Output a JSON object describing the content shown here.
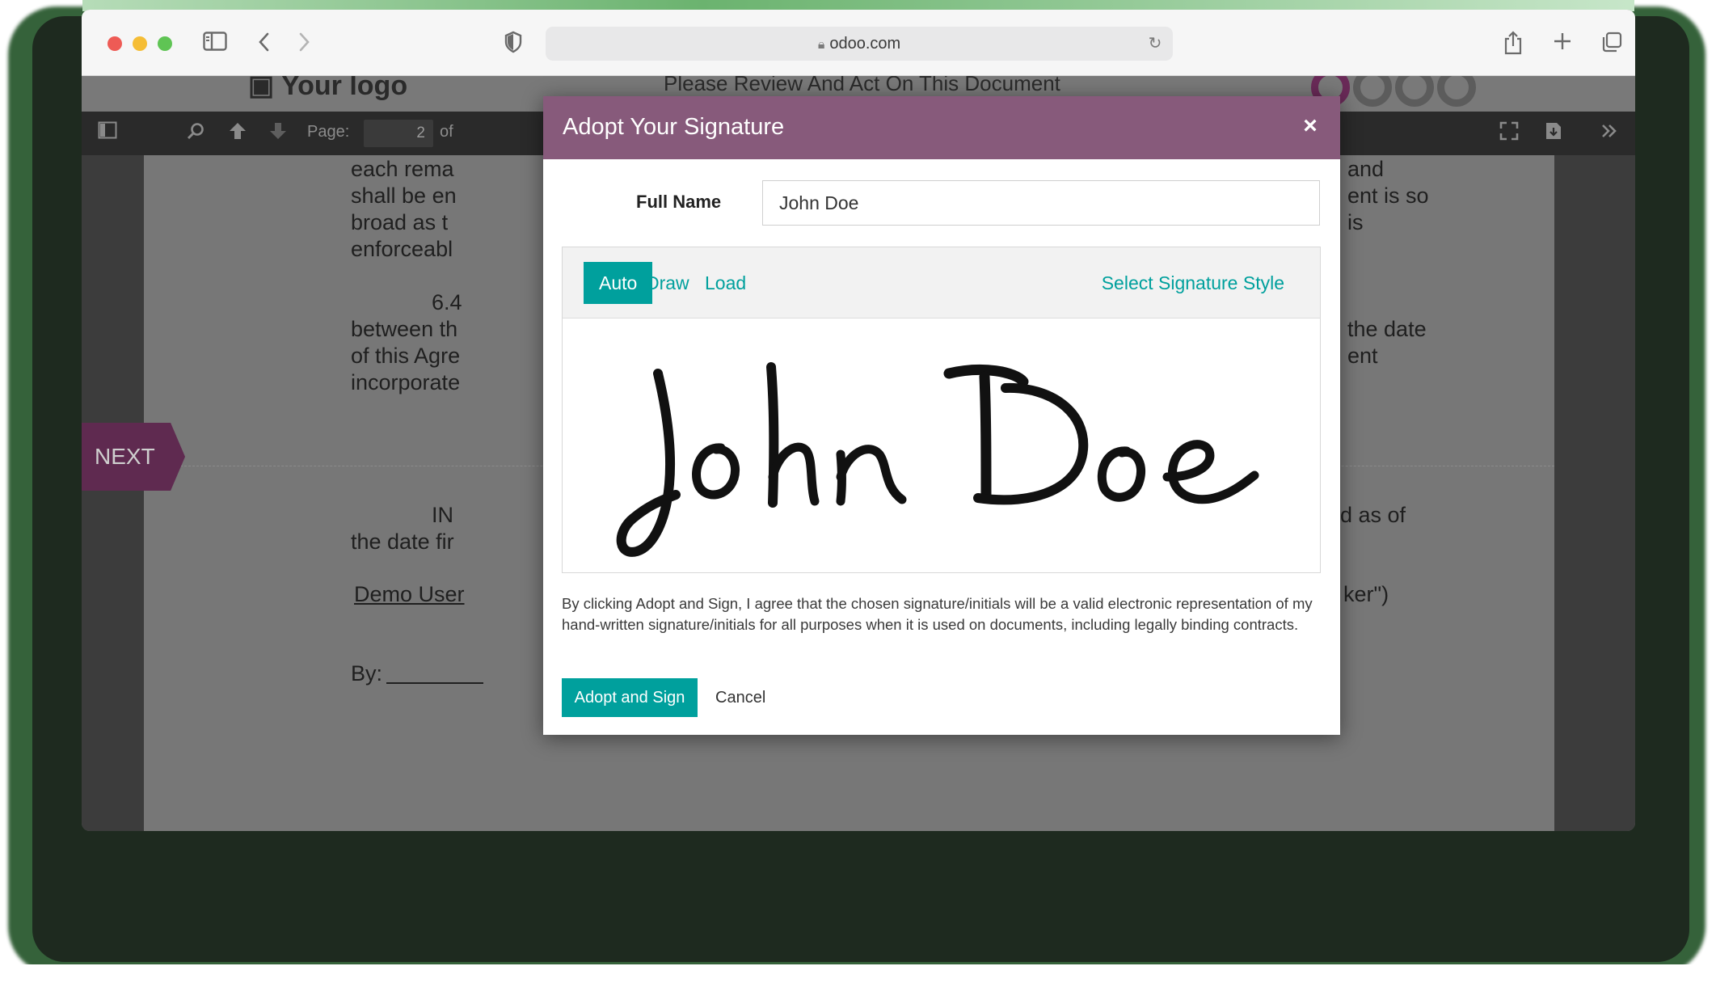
{
  "browser": {
    "url": "odoo.com"
  },
  "page_header": {
    "logo_text": "Your logo",
    "title": "Please Review And Act On This Document"
  },
  "pdf_toolbar": {
    "page_label": "Page:",
    "page_number": "2",
    "of_label": "of"
  },
  "document": {
    "lines_left": [
      "each rema",
      "shall be en",
      "broad as t",
      "enforceabl",
      "6.4",
      "between th",
      "of this Agre",
      "incorporate",
      "IN",
      "the date fir",
      "Demo User",
      "By:"
    ],
    "lines_right": [
      "and",
      "ent is so",
      "is",
      "the date",
      "ent",
      "d as of",
      "ker\")"
    ],
    "next_label": "NEXT"
  },
  "modal": {
    "title": "Adopt Your Signature",
    "close_glyph": "×",
    "full_name_label": "Full Name",
    "full_name_value": "John Doe",
    "tabs": [
      "Auto",
      "Draw",
      "Load"
    ],
    "active_tab": "Auto",
    "style_link": "Select Signature Style",
    "signature_text": "John Doe",
    "agreement_text": "By clicking Adopt and Sign, I agree that the chosen signature/initials will be a valid electronic representation of my hand-written signature/initials for all purposes when it is used on documents, including legally binding contracts.",
    "adopt_button": "Adopt and Sign",
    "cancel_button": "Cancel"
  },
  "colors": {
    "modal_header": "#875a7b",
    "accent_teal": "#00a09d",
    "next_tab": "#5f2a50"
  }
}
